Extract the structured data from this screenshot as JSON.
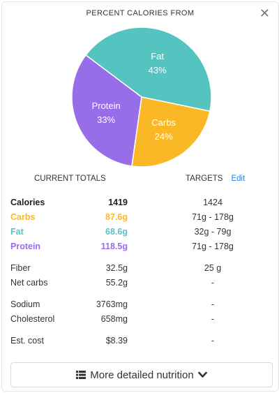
{
  "header": {
    "title": "PERCENT CALORIES FROM",
    "close_glyph": "✕"
  },
  "chart_data": {
    "type": "pie",
    "title": "PERCENT CALORIES FROM",
    "slices": [
      {
        "name": "Fat",
        "label": "43%",
        "value": 43,
        "color": "#55c3c0"
      },
      {
        "name": "Carbs",
        "label": "24%",
        "value": 24,
        "color": "#fbb826"
      },
      {
        "name": "Protein",
        "label": "33%",
        "value": 33,
        "color": "#986de8"
      }
    ]
  },
  "totals": {
    "current_header": "CURRENT TOTALS",
    "targets_header": "TARGETS",
    "edit_label": "Edit",
    "rows": [
      {
        "label": "Calories",
        "value": "1419",
        "target": "1424",
        "color": "#222222",
        "bold": true
      },
      {
        "label": "Carbs",
        "value": "87.6g",
        "target": "71g - 178g",
        "color": "#fbb826",
        "bold": true
      },
      {
        "label": "Fat",
        "value": "68.6g",
        "target": "32g - 79g",
        "color": "#55c3c0",
        "bold": true
      },
      {
        "label": "Protein",
        "value": "118.5g",
        "target": "71g - 178g",
        "color": "#986de8",
        "bold": true
      },
      {
        "label": "Fiber",
        "value": "32.5g",
        "target": "25 g",
        "color": "#333333",
        "bold": false
      },
      {
        "label": "Net carbs",
        "value": "55.2g",
        "target": "-",
        "color": "#333333",
        "bold": false
      },
      {
        "label": "Sodium",
        "value": "3763mg",
        "target": "-",
        "color": "#333333",
        "bold": false
      },
      {
        "label": "Cholesterol",
        "value": "658mg",
        "target": "-",
        "color": "#333333",
        "bold": false
      },
      {
        "label": "Est. cost",
        "value": "$8.39",
        "target": "-",
        "color": "#333333",
        "bold": false
      }
    ]
  },
  "footer": {
    "more_label": "More detailed nutrition",
    "list_icon": "list-icon",
    "chevron_icon": "chevron-down-icon"
  }
}
